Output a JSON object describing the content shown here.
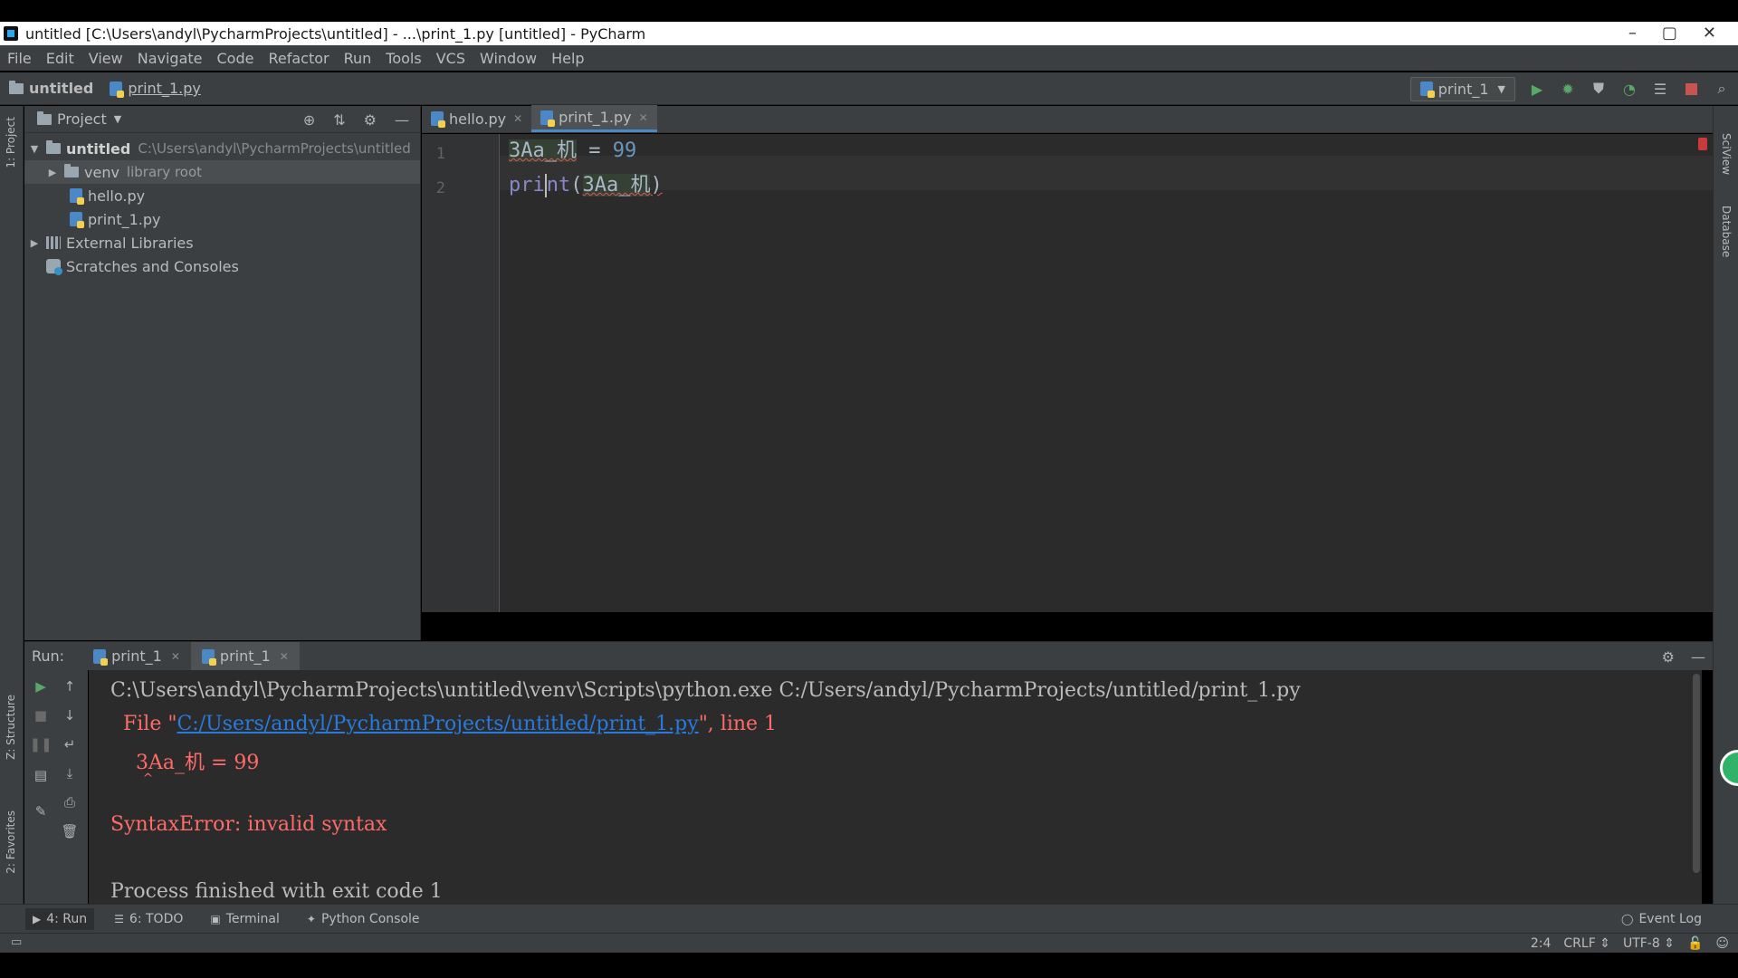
{
  "window": {
    "title": "untitled [C:\\Users\\andyl\\PycharmProjects\\untitled] - ...\\print_1.py [untitled] - PyCharm"
  },
  "menu": [
    "File",
    "Edit",
    "View",
    "Navigate",
    "Code",
    "Refactor",
    "Run",
    "Tools",
    "VCS",
    "Window",
    "Help"
  ],
  "breadcrumb": {
    "project": "untitled",
    "file": "print_1.py"
  },
  "run_config": {
    "selected": "print_1"
  },
  "project_panel": {
    "title": "Project",
    "tree": {
      "root_name": "untitled",
      "root_path": "C:\\Users\\andyl\\PycharmProjects\\untitled",
      "venv_name": "venv",
      "venv_note": "library root",
      "file1": "hello.py",
      "file2": "print_1.py",
      "external": "External Libraries",
      "scratches": "Scratches and Consoles"
    }
  },
  "sidebar_left": {
    "project": "1: Project",
    "structure": "Z: Structure",
    "favorites": "2: Favorites"
  },
  "sidebar_right": {
    "sciview": "SciView",
    "database": "Database"
  },
  "editor": {
    "tabs": [
      "hello.py",
      "print_1.py"
    ],
    "line_numbers": [
      "1",
      "2"
    ],
    "line1": {
      "ident": "3Aa_机",
      "op": " = ",
      "num": "99"
    },
    "line2": {
      "fn_a": "pri",
      "fn_b": "nt",
      "open": "(",
      "arg": "3Aa_机",
      "close": ")"
    }
  },
  "run_panel": {
    "label": "Run:",
    "tabs": [
      "print_1",
      "print_1"
    ],
    "console": {
      "cmd": "C:\\Users\\andyl\\PycharmProjects\\untitled\\venv\\Scripts\\python.exe C:/Users/andyl/PycharmProjects/untitled/print_1.py",
      "file_prefix": "  File \"",
      "file_link": "C:/Users/andyl/PycharmProjects/untitled/print_1.py",
      "file_suffix": "\", line 1",
      "code": "    3Aa_机 = 99",
      "caret": "        ^",
      "error": "SyntaxError: invalid syntax",
      "exit": "Process finished with exit code 1"
    }
  },
  "bottom_tools": {
    "run": "4: Run",
    "todo": "6: TODO",
    "terminal": "Terminal",
    "python_console": "Python Console",
    "event_log": "Event Log"
  },
  "status": {
    "position": "2:4",
    "line_sep": "CRLF",
    "encoding": "UTF-8"
  },
  "colors": {
    "accent": "#4a88c7",
    "error": "#ff6b68",
    "link": "#287bde",
    "run_green": "#59a869",
    "stop_red": "#c75450"
  }
}
